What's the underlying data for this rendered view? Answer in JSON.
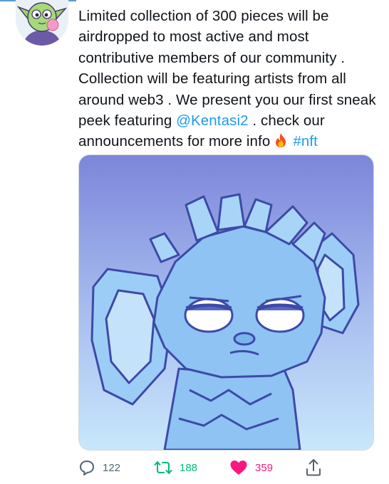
{
  "tweet": {
    "text_main": "Limited collection of 300 pieces will be airdropped to most active and most contributive members of our community . Collection will be featuring artists from all around web3 . We present you our first sneak peek featuring ",
    "mention": "@Kentasi2",
    "text_after_mention": " . check our announcements for more info",
    "hashtag": "#nft"
  },
  "actions": {
    "replies": "122",
    "retweets": "188",
    "likes": "359"
  },
  "colors": {
    "link": "#1d9bf0",
    "retweet": "#00ba7c",
    "like": "#f91880",
    "icon": "#536471"
  },
  "icons": {
    "reply": "reply-icon",
    "retweet": "retweet-icon",
    "like": "heart-icon",
    "share": "share-icon",
    "emoji": "fire-emoji"
  }
}
